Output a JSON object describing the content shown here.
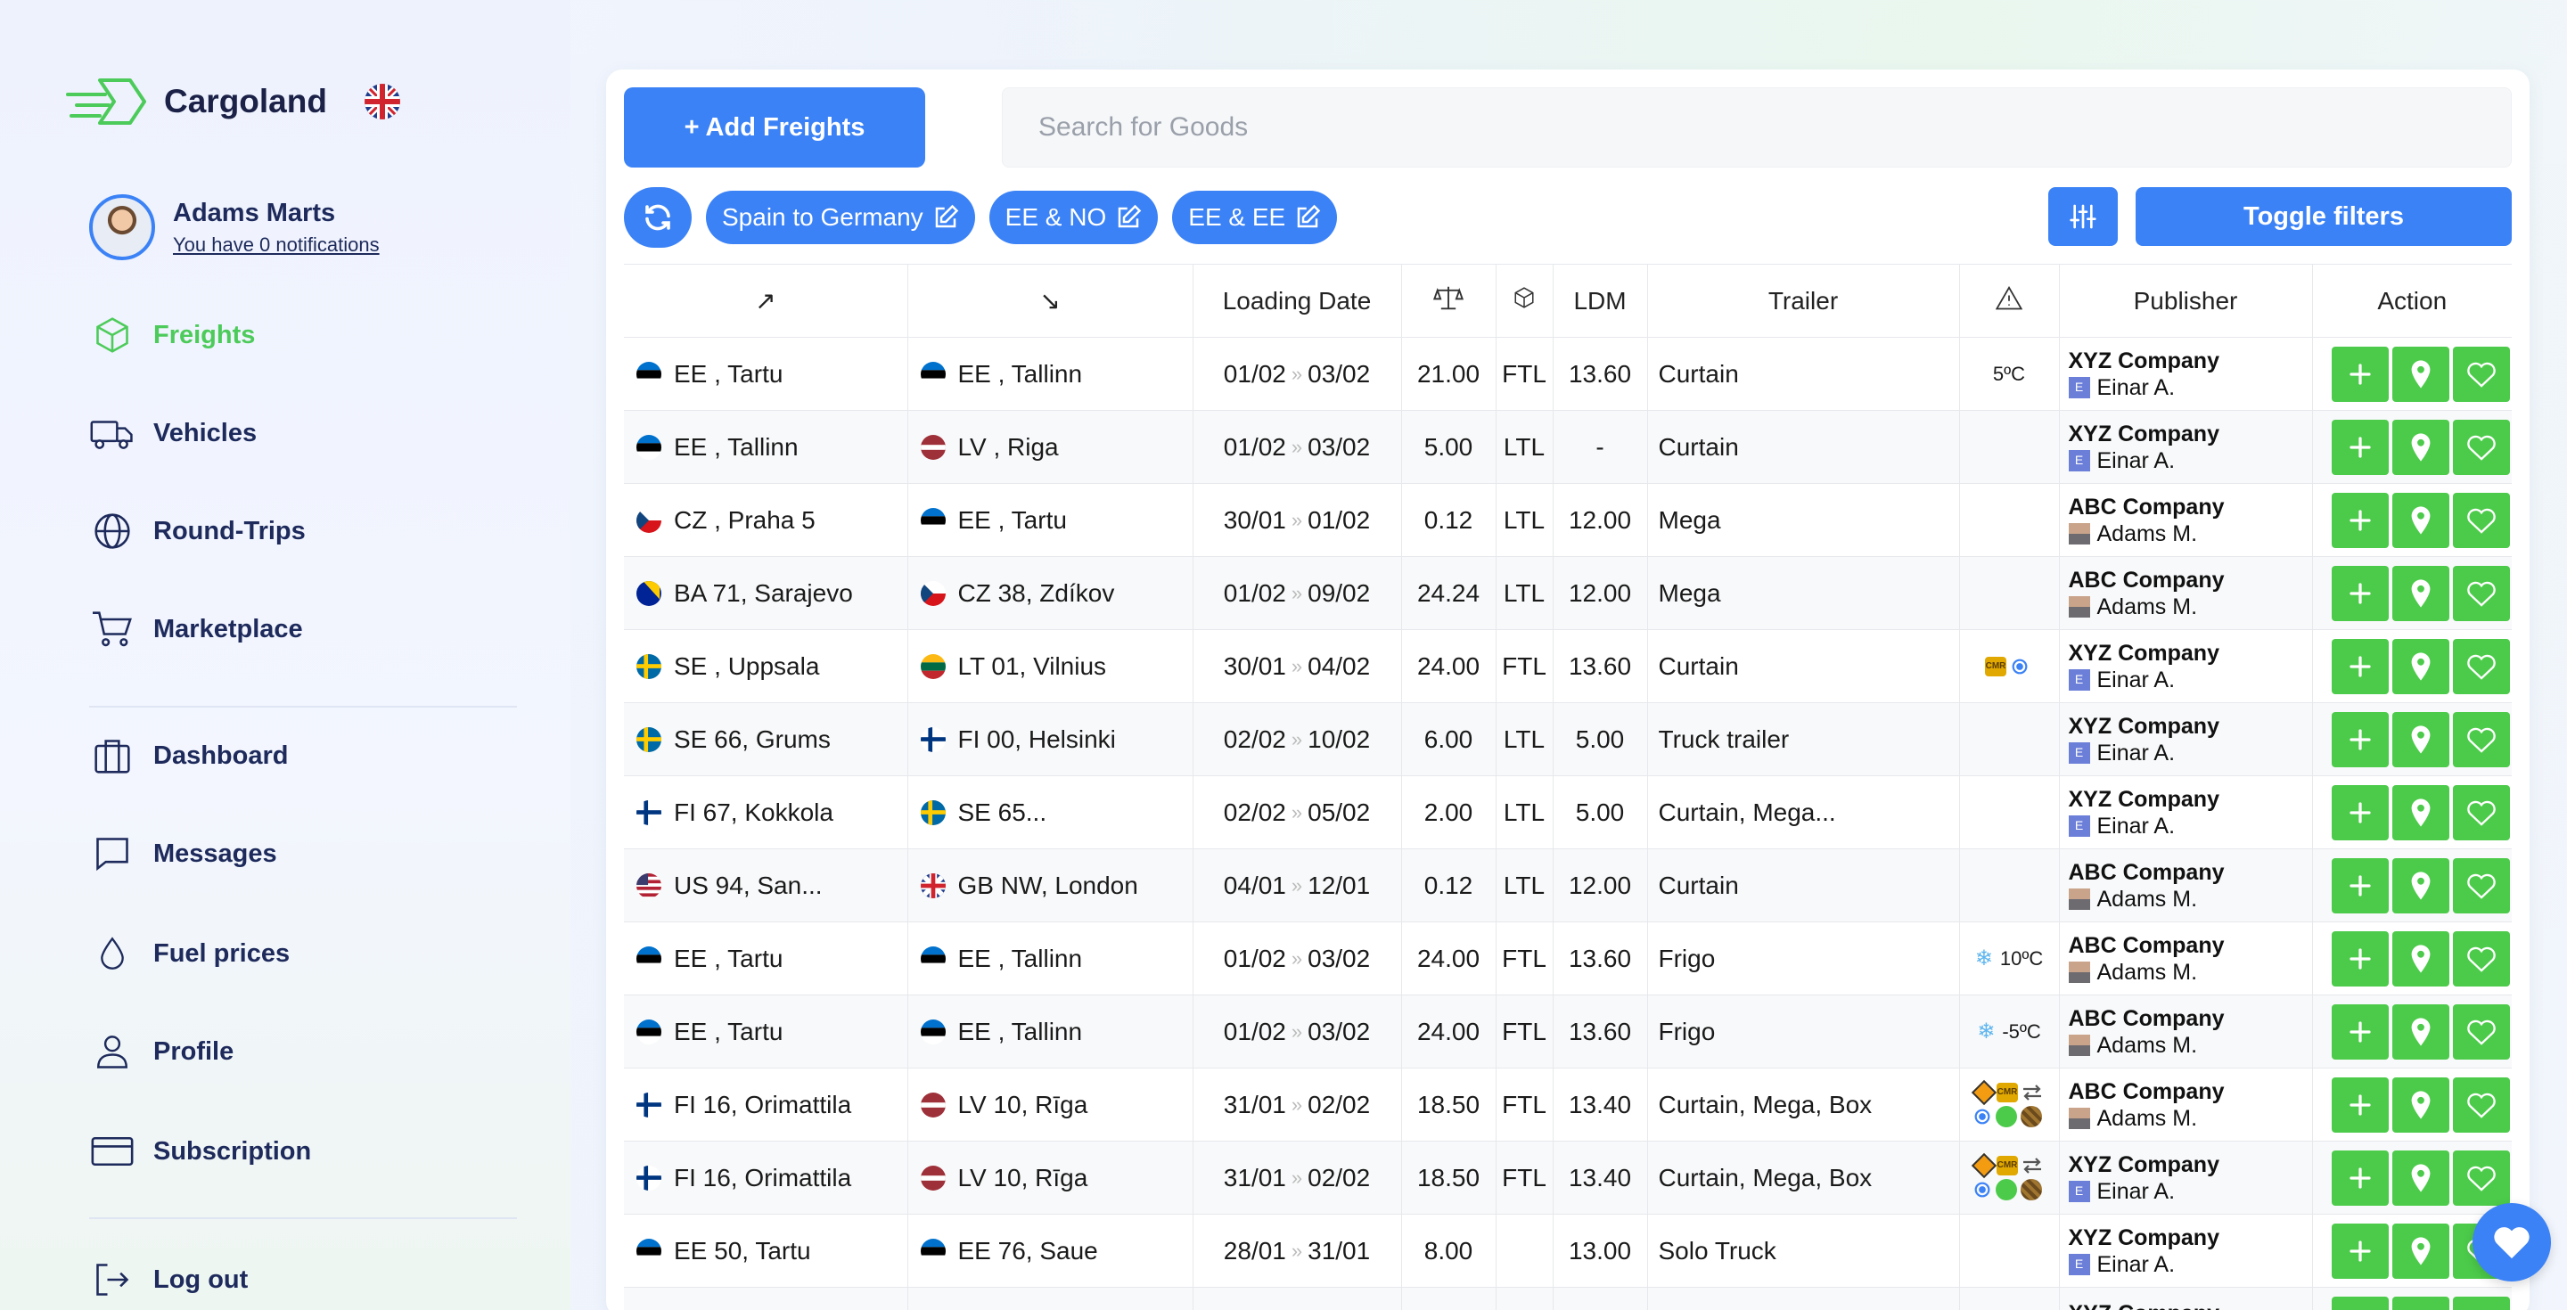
{
  "brand": {
    "name": "Cargoland",
    "language_flag": "gb-flag-icon"
  },
  "user": {
    "name": "Adams Marts",
    "notifications": "You have 0 notifications"
  },
  "nav": [
    {
      "label": "Freights",
      "icon": "cube-icon",
      "active": true
    },
    {
      "label": "Vehicles",
      "icon": "truck-icon",
      "active": false
    },
    {
      "label": "Round-Trips",
      "icon": "globe-icon",
      "active": false
    },
    {
      "label": "Marketplace",
      "icon": "cart-icon",
      "active": false
    },
    {
      "label": "Dashboard",
      "icon": "briefcase-icon",
      "active": false
    },
    {
      "label": "Messages",
      "icon": "chat-icon",
      "active": false
    },
    {
      "label": "Fuel prices",
      "icon": "drop-icon",
      "active": false
    },
    {
      "label": "Profile",
      "icon": "user-icon",
      "active": false
    },
    {
      "label": "Subscription",
      "icon": "card-icon",
      "active": false
    },
    {
      "label": "Log out",
      "icon": "logout-icon",
      "active": false
    }
  ],
  "toolbar": {
    "add_label": "+ Add Freights",
    "search_placeholder": "Search for Goods",
    "chips": [
      "Spain to Germany",
      "EE & NO",
      "EE & EE"
    ],
    "toggle_label": "Toggle filters"
  },
  "colors": {
    "primary": "#3b82f6",
    "accent_green": "#4ccb4a",
    "text_dark": "#1d2a5b"
  },
  "table": {
    "headers": {
      "from": "↗",
      "to": "↘",
      "loading_date": "Loading Date",
      "weight": "scale-icon",
      "type": "box-icon",
      "ldm": "LDM",
      "trailer": "Trailer",
      "warnings": "warning-icon",
      "publisher": "Publisher",
      "action": "Action"
    },
    "rows": [
      {
        "from_flag": "ee",
        "from": "EE , Tartu",
        "to_flag": "ee",
        "to": "EE , Tallinn",
        "d1": "01/02",
        "d2": "03/02",
        "weight": "21.00",
        "type": "FTL",
        "ldm": "13.60",
        "trailer": "Curtain",
        "warn_text": "5ºC",
        "warn_icons": [],
        "company": "XYZ Company",
        "person": "Einar A.",
        "badge": "e"
      },
      {
        "from_flag": "ee",
        "from": "EE , Tallinn",
        "to_flag": "lv",
        "to": "LV , Riga",
        "d1": "01/02",
        "d2": "03/02",
        "weight": "5.00",
        "type": "LTL",
        "ldm": "-",
        "trailer": "Curtain",
        "warn_text": "",
        "warn_icons": [],
        "company": "XYZ Company",
        "person": "Einar A.",
        "badge": "e"
      },
      {
        "from_flag": "cz",
        "from": "CZ , Praha 5",
        "to_flag": "ee",
        "to": "EE , Tartu",
        "d1": "30/01",
        "d2": "01/02",
        "weight": "0.12",
        "type": "LTL",
        "ldm": "12.00",
        "trailer": "Mega",
        "warn_text": "",
        "warn_icons": [],
        "company": "ABC Company",
        "person": "Adams M.",
        "badge": "p"
      },
      {
        "from_flag": "ba",
        "from": "BA 71, Sarajevo",
        "to_flag": "cz",
        "to": "CZ 38, Zdíkov",
        "d1": "01/02",
        "d2": "09/02",
        "weight": "24.24",
        "type": "LTL",
        "ldm": "12.00",
        "trailer": "Mega",
        "warn_text": "",
        "warn_icons": [],
        "company": "ABC Company",
        "person": "Adams M.",
        "badge": "p"
      },
      {
        "from_flag": "se",
        "from": "SE , Uppsala",
        "to_flag": "lt",
        "to": "LT 01, Vilnius",
        "d1": "30/01",
        "d2": "04/02",
        "weight": "24.00",
        "type": "FTL",
        "ldm": "13.60",
        "trailer": "Curtain",
        "warn_text": "",
        "warn_icons": [
          "cmr",
          "target"
        ],
        "company": "XYZ Company",
        "person": "Einar A.",
        "badge": "e"
      },
      {
        "from_flag": "se",
        "from": "SE 66, Grums",
        "to_flag": "fi",
        "to": "FI 00, Helsinki",
        "d1": "02/02",
        "d2": "10/02",
        "weight": "6.00",
        "type": "LTL",
        "ldm": "5.00",
        "trailer": "Truck trailer",
        "warn_text": "",
        "warn_icons": [],
        "company": "XYZ Company",
        "person": "Einar A.",
        "badge": "e"
      },
      {
        "from_flag": "fi",
        "from": "FI 67, Kokkola",
        "to_flag": "se",
        "to": "SE 65...",
        "d1": "02/02",
        "d2": "05/02",
        "weight": "2.00",
        "type": "LTL",
        "ldm": "5.00",
        "trailer": "Curtain, Mega...",
        "warn_text": "",
        "warn_icons": [],
        "company": "XYZ Company",
        "person": "Einar A.",
        "badge": "e"
      },
      {
        "from_flag": "us",
        "from": "US 94, San...",
        "to_flag": "gb",
        "to": "GB NW, London",
        "d1": "04/01",
        "d2": "12/01",
        "weight": "0.12",
        "type": "LTL",
        "ldm": "12.00",
        "trailer": "Curtain",
        "warn_text": "",
        "warn_icons": [],
        "company": "ABC Company",
        "person": "Adams M.",
        "badge": "p"
      },
      {
        "from_flag": "ee",
        "from": "EE , Tartu",
        "to_flag": "ee",
        "to": "EE , Tallinn",
        "d1": "01/02",
        "d2": "03/02",
        "weight": "24.00",
        "type": "FTL",
        "ldm": "13.60",
        "trailer": "Frigo",
        "warn_text": "10ºC",
        "warn_icons": [
          "snow"
        ],
        "company": "ABC Company",
        "person": "Adams M.",
        "badge": "p"
      },
      {
        "from_flag": "ee",
        "from": "EE , Tartu",
        "to_flag": "ee",
        "to": "EE , Tallinn",
        "d1": "01/02",
        "d2": "03/02",
        "weight": "24.00",
        "type": "FTL",
        "ldm": "13.60",
        "trailer": "Frigo",
        "warn_text": "-5ºC",
        "warn_icons": [
          "snow"
        ],
        "company": "ABC Company",
        "person": "Adams M.",
        "badge": "p"
      },
      {
        "from_flag": "fi",
        "from": "FI 16, Orimattila",
        "to_flag": "lv",
        "to": "LV 10, Rīga",
        "d1": "31/01",
        "d2": "02/02",
        "weight": "18.50",
        "type": "FTL",
        "ldm": "13.40",
        "trailer": "Curtain, Mega, Box",
        "warn_text": "",
        "warn_icons": [
          "adr",
          "cmr",
          "swap",
          "target",
          "green",
          "barrel"
        ],
        "company": "ABC Company",
        "person": "Adams M.",
        "badge": "p"
      },
      {
        "from_flag": "fi",
        "from": "FI 16, Orimattila",
        "to_flag": "lv",
        "to": "LV 10, Rīga",
        "d1": "31/01",
        "d2": "02/02",
        "weight": "18.50",
        "type": "FTL",
        "ldm": "13.40",
        "trailer": "Curtain, Mega, Box",
        "warn_text": "",
        "warn_icons": [
          "adr",
          "cmr",
          "swap",
          "target",
          "green",
          "barrel"
        ],
        "company": "XYZ Company",
        "person": "Einar A.",
        "badge": "e"
      },
      {
        "from_flag": "ee",
        "from": "EE 50, Tartu",
        "to_flag": "ee",
        "to": "EE 76, Saue",
        "d1": "28/01",
        "d2": "31/01",
        "weight": "8.00",
        "type": "",
        "ldm": "13.00",
        "trailer": "Solo Truck",
        "warn_text": "",
        "warn_icons": [],
        "company": "XYZ Company",
        "person": "Einar A.",
        "badge": "e"
      },
      {
        "from_flag": "ee",
        "from": "",
        "to_flag": "ee",
        "to": "",
        "d1": "",
        "d2": "",
        "weight": "",
        "type": "",
        "ldm": "",
        "trailer": "",
        "warn_text": "",
        "warn_icons": [],
        "company": "XYZ Company",
        "person": "",
        "badge": "e"
      }
    ]
  }
}
